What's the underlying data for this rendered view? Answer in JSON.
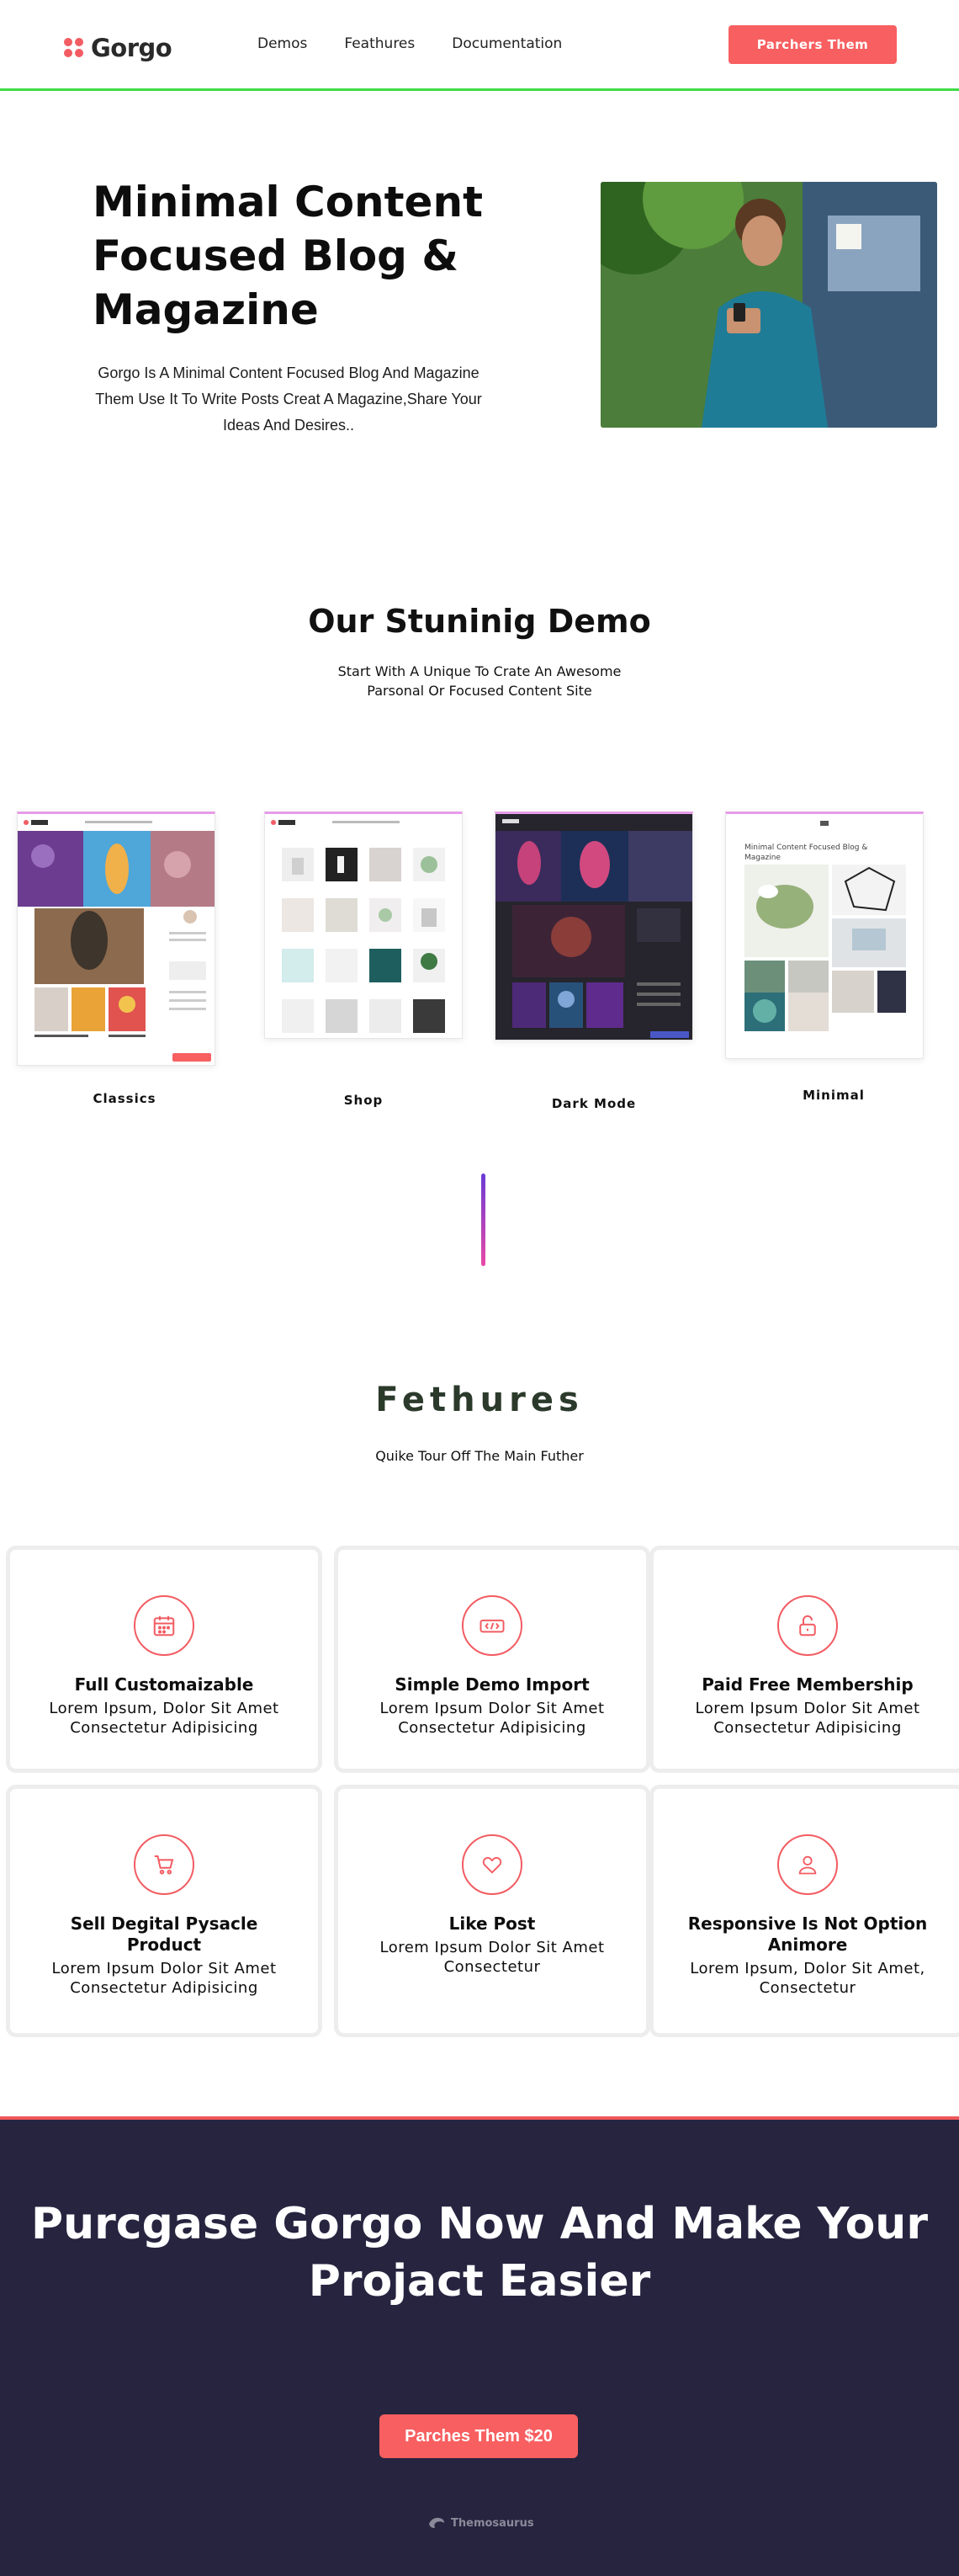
{
  "nav": {
    "logo": "Gorgo",
    "items": [
      "Demos",
      "Feathures",
      "Documentation"
    ],
    "cta": "Parchers Them"
  },
  "hero": {
    "title": "Minimal Content Focused Blog & Magazine",
    "description": "Gorgo Is A Minimal Content Focused Blog And Magazine Them Use It To Write Posts Creat A Magazine,Share Your Ideas And Desires.."
  },
  "demo": {
    "title": "Our Stuninig Demo",
    "subtitle": "Start With A Unique To Crate An Awesome Parsonal Or Focused Content Site",
    "cards": [
      {
        "label": "Classics"
      },
      {
        "label": "Shop"
      },
      {
        "label": "Dark Mode"
      },
      {
        "label": "Minimal",
        "preview_heading": "Minimal Content Focused Blog & Magazine"
      }
    ]
  },
  "features": {
    "title": "Fethures",
    "subtitle": "Quike Tour Off The Main Futher",
    "items": [
      {
        "icon": "calendar-icon",
        "title": "Full Customaizable",
        "text": "Lorem Ipsum, Dolor Sit Amet Consectetur Adipisicing"
      },
      {
        "icon": "import-icon",
        "title": "Simple Demo Import",
        "text": "Lorem Ipsum Dolor Sit Amet Consectetur Adipisicing"
      },
      {
        "icon": "lock-icon",
        "title": "Paid Free Membership",
        "text": "Lorem Ipsum Dolor Sit Amet Consectetur Adipisicing"
      },
      {
        "icon": "cart-icon",
        "title": "Sell Degital Pysacle Product",
        "text": "Lorem Ipsum Dolor Sit Amet Consectetur Adipisicing"
      },
      {
        "icon": "heart-icon",
        "title": "Like Post",
        "text": "Lorem Ipsum Dolor Sit Amet Consectetur"
      },
      {
        "icon": "user-icon",
        "title": "Responsive Is Not Option Animore",
        "text": "Lorem Ipsum, Dolor Sit Amet, Consectetur"
      }
    ]
  },
  "cta": {
    "title": "Purcgase Gorgo Now And Make Your Projact Easier",
    "button": "Parches Them $20",
    "brand": "Themosaurus"
  },
  "colors": {
    "accent": "#f85f60",
    "dark_bg": "#26243f",
    "nav_border": "#3ddc45"
  }
}
